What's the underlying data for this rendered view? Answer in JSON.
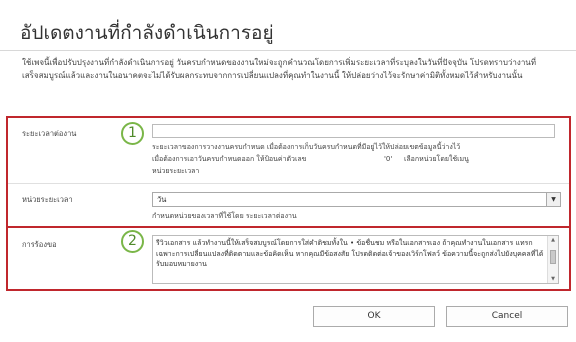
{
  "dialog": {
    "title": "อัปเดตงานที่กำลังดำเนินการอยู่",
    "intro": "ใช้เพจนี้เพื่อปรับปรุงงานที่กำลังดำเนินการอยู่ วันครบกำหนดของงานใหม่จะถูกคำนวณโดยการเพิ่มระยะเวลาที่ระบุลงในวันที่ปัจจุบัน โปรดทราบว่างานที่เสร็จสมบูรณ์แล้วและงานในอนาคตจะไม่ได้รับผลกระทบจากการเปลี่ยนแปลงที่คุณทำในงานนี้ ให้ปล่อยว่างไว้จะรักษาค่ามิติทั้งหมดไว้สำหรับงานนั้น"
  },
  "fields": {
    "duration": {
      "badge": "1",
      "label": "ระยะเวลาต่องาน",
      "value": "",
      "help_line1": "ระยะเวลาของการวางงานครบกำหนด เมื่อต้องการเก็บวันครบกำหนดที่มีอยู่ไว้ให้ปล่อยเขตข้อมูลนี้ว่างไว้",
      "help_line2": "เมื่อต้องการเอาวันครบกำหนดออก ให้ป้อนค่าตัวเลข",
      "help_zero": "'0'",
      "help_line2_tail": "เลือกหน่วยโดยใช้เมนู",
      "help_line3": "หน่วยระยะเวลา"
    },
    "duration_unit": {
      "label": "หน่วยระยะเวลา",
      "selected": "วัน",
      "arrow_icon": "chevron-down-icon",
      "help": "กำหนดหน่วยของเวลาที่ใช้โดย ระยะเวลาต่องาน"
    },
    "comments": {
      "badge": "2",
      "label": "การร้องขอ",
      "value": "รีวิวเอกสาร แล้วทำงานนี้ให้เสร็จสมบูรณ์โดยการใส่คำติชมทั้งใน • ข้อชื่นชม หรือในเอกสารเอง ถ้าคุณทำงานในเอกสาร แทรกเฉพาะการเปลี่ยนแปลงที่ติดตามและข้อคิดเห็น หากคุณมีข้อสงสัย โปรดติดต่อเจ้าของเวิร์กโฟลว์ ข้อความนี้จะถูกส่งไปยังบุคคลที่ได้รับมอบหมายงาน"
    }
  },
  "buttons": {
    "ok": "OK",
    "cancel": "Cancel"
  },
  "colors": {
    "highlight_border": "#c0272d",
    "badge_green": "#7ab648"
  }
}
